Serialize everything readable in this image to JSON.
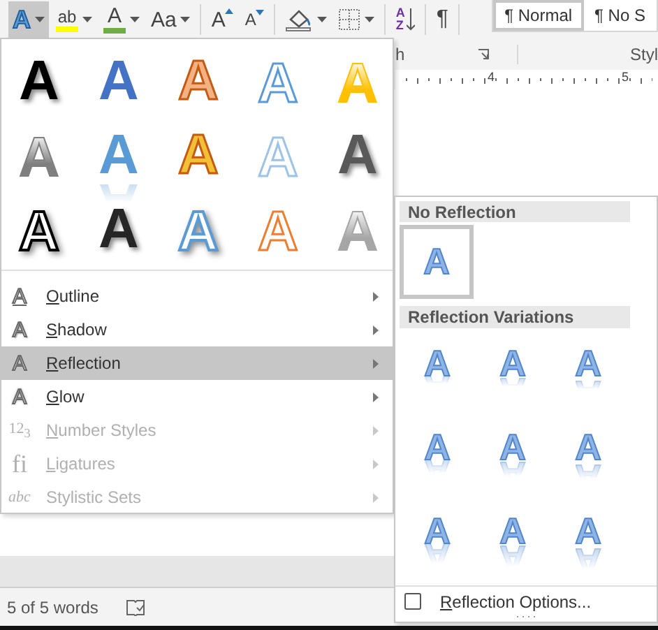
{
  "toolbar": {
    "groups": [
      [
        {
          "kind": "text-effects",
          "label": "A",
          "pressed": true,
          "dropdown": true
        },
        {
          "kind": "highlight",
          "label": "ab",
          "color": "#ffff00",
          "pressed": false,
          "dropdown": true
        },
        {
          "kind": "font-color",
          "label": "A",
          "color": "#70ad47",
          "pressed": false,
          "dropdown": true
        },
        {
          "kind": "change-case",
          "label": "Aa",
          "pressed": false,
          "dropdown": true
        }
      ],
      [
        {
          "kind": "grow-font",
          "label": "A",
          "pressed": false,
          "dropdown": false
        },
        {
          "kind": "shrink-font",
          "label": "A",
          "pressed": false,
          "dropdown": false
        }
      ],
      [
        {
          "kind": "shading",
          "pressed": false,
          "dropdown": true
        },
        {
          "kind": "borders",
          "pressed": false,
          "dropdown": true
        }
      ],
      [
        {
          "kind": "sort",
          "label": "AZ",
          "pressed": false,
          "dropdown": false
        }
      ],
      [
        {
          "kind": "paragraph",
          "label": "¶",
          "pressed": false,
          "dropdown": false
        }
      ]
    ],
    "styles": [
      {
        "label": "¶ Normal",
        "selected": true
      },
      {
        "label": "¶ No S",
        "selected": false
      }
    ]
  },
  "group_labels": {
    "paragraph": "h",
    "styles": "Styl"
  },
  "ruler": {
    "labels": [
      "4",
      "5"
    ]
  },
  "text_effects_menu": {
    "gallery": [
      {
        "label": "A",
        "kind": "shadow",
        "color": "#000000"
      },
      {
        "label": "A",
        "kind": "solid",
        "color": "#4472c4"
      },
      {
        "label": "A",
        "kind": "outline-filled",
        "color": "#f4b183"
      },
      {
        "label": "A",
        "kind": "outline-blue"
      },
      {
        "label": "A",
        "kind": "gradient-gold"
      },
      {
        "label": "A",
        "kind": "gradient-grey"
      },
      {
        "label": "A",
        "kind": "reflection",
        "color": "#5b9bd5"
      },
      {
        "label": "A",
        "kind": "outline-filled",
        "color": "#f2c037"
      },
      {
        "label": "A",
        "kind": "outline-light-blue"
      },
      {
        "label": "A",
        "kind": "shadow",
        "color": "#595959"
      },
      {
        "label": "A",
        "kind": "outline-shadow-black"
      },
      {
        "label": "A",
        "kind": "shadow",
        "color": "#262626"
      },
      {
        "label": "A",
        "kind": "outline-shadow-blue"
      },
      {
        "label": "A",
        "kind": "outline-orange"
      },
      {
        "label": "A",
        "kind": "gradient-silver"
      }
    ],
    "items": [
      {
        "icon_text": "A",
        "label": "Outline",
        "access_key": true,
        "disabled": false,
        "selected": false,
        "submenu": true
      },
      {
        "icon_text": "A",
        "label": "Shadow",
        "access_key": true,
        "disabled": false,
        "selected": false,
        "submenu": true
      },
      {
        "icon_text": "A",
        "label": "Reflection",
        "access_key": true,
        "disabled": false,
        "selected": true,
        "submenu": true
      },
      {
        "icon_text": "A",
        "label": "Glow",
        "access_key": true,
        "disabled": false,
        "selected": false,
        "submenu": true
      },
      {
        "icon_text": "12$_{3}$",
        "label": "Number Styles",
        "access_key": true,
        "disabled": true,
        "selected": false,
        "submenu": true
      },
      {
        "icon_text": "fi",
        "label": "Ligatures",
        "access_key": true,
        "disabled": true,
        "selected": false,
        "submenu": true
      },
      {
        "icon_text": "abc",
        "label": "Stylistic Sets",
        "access_key": false,
        "disabled": true,
        "selected": false,
        "submenu": true
      }
    ]
  },
  "reflection_submenu": {
    "sections": [
      {
        "kind": "none",
        "title": "No Reflection",
        "items": [
          {
            "label": "A",
            "selected": true
          }
        ]
      },
      {
        "kind": "variations",
        "title": "Reflection Variations",
        "items": [
          {
            "label": "A",
            "selected": false
          },
          {
            "label": "A",
            "selected": false
          },
          {
            "label": "A",
            "selected": false
          },
          {
            "label": "A",
            "selected": false
          },
          {
            "label": "A",
            "selected": false
          },
          {
            "label": "A",
            "selected": false
          },
          {
            "label": "A",
            "selected": false
          },
          {
            "label": "A",
            "selected": false
          },
          {
            "label": "A",
            "selected": false
          }
        ]
      }
    ],
    "options": {
      "label": "Reflection Options...",
      "access_key": true
    }
  },
  "status_bar": {
    "word_count": "5 of 5 words"
  }
}
